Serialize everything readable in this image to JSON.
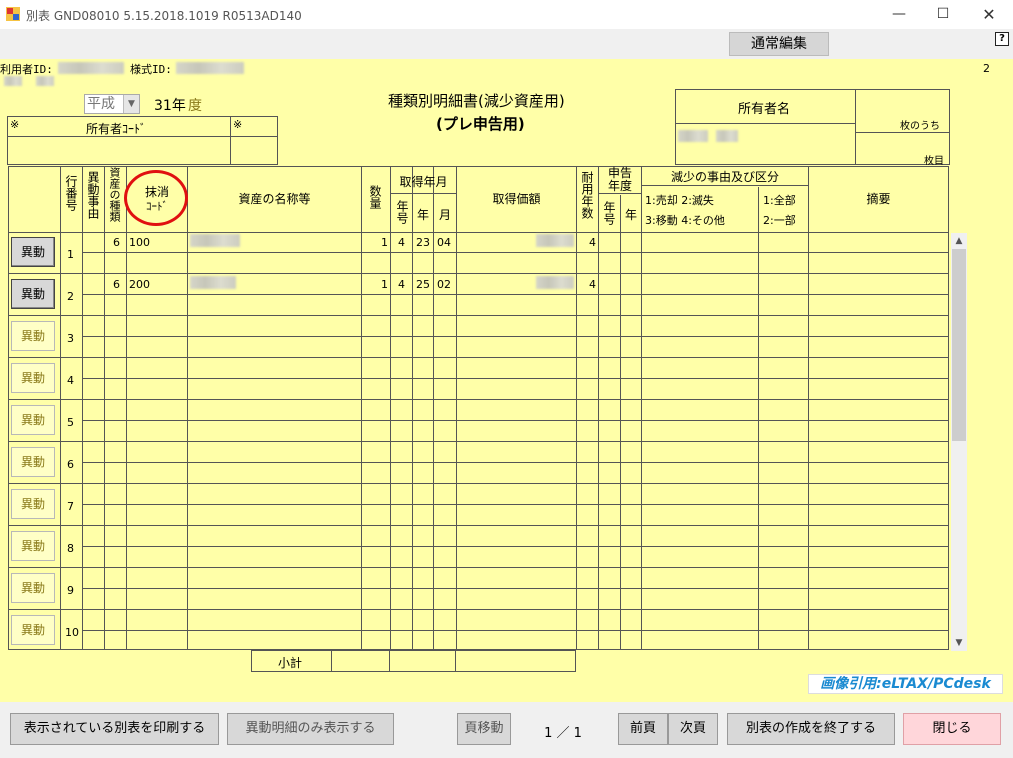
{
  "window": {
    "title": "別表 GND08010  5.15.2018.1019  R0513AD140",
    "minimize": "—",
    "maximize": "☐",
    "close": "✕"
  },
  "mode_button": "通常編集",
  "help": "?",
  "page_count": "2",
  "user_id_label": "利用者ID:",
  "form_id_label": "様式ID:",
  "era": {
    "selected": "平成",
    "year_text": "31年",
    "year_suffix": "度"
  },
  "form_title": "種類別明細書(減少資産用)",
  "form_subtitle": "(プレ申告用)",
  "owner_code": {
    "mark_left": "※",
    "label": "所有者ｺｰﾄﾞ",
    "mark_right": "※"
  },
  "owner_box": {
    "label": "所有者名",
    "sheets_of": "枚のうち",
    "sheet_no": "枚目"
  },
  "headers": {
    "row_no": "行番号",
    "change_reason": "異動事由",
    "asset_type": "資産の種類",
    "strike_code_1": "抹消",
    "strike_code_2": "ｺｰﾄﾞ",
    "asset_name": "資産の名称等",
    "quantity": "数量",
    "acq_date": "取得年月",
    "era": "年号",
    "year": "年",
    "month": "月",
    "acq_price": "取得価額",
    "useful_life": "耐用年数",
    "decl_year": "申告年度",
    "decl_era": "年号",
    "decl_y": "年",
    "reason_header": "減少の事由及び区分",
    "reason_codes_1": "1:売却 2:滅失",
    "reason_codes_2": "3:移動 4:その他",
    "scope_1": "1:全部",
    "scope_2": "2:一部",
    "remarks": "摘要"
  },
  "rows": [
    {
      "button": "異動",
      "no": "1",
      "type": "6",
      "code": "100",
      "qty": "1",
      "era": "4",
      "year": "23",
      "month": "04",
      "life": "4",
      "active": true
    },
    {
      "button": "異動",
      "no": "2",
      "type": "6",
      "code": "200",
      "qty": "1",
      "era": "4",
      "year": "25",
      "month": "02",
      "life": "4",
      "active": true
    },
    {
      "button": "異動",
      "no": "3",
      "active": false
    },
    {
      "button": "異動",
      "no": "4",
      "active": false
    },
    {
      "button": "異動",
      "no": "5",
      "active": false
    },
    {
      "button": "異動",
      "no": "6",
      "active": false
    },
    {
      "button": "異動",
      "no": "7",
      "active": false
    },
    {
      "button": "異動",
      "no": "8",
      "active": false
    },
    {
      "button": "異動",
      "no": "9",
      "active": false
    },
    {
      "button": "異動",
      "no": "10",
      "active": false
    }
  ],
  "subtotal_label": "小計",
  "credit": "画像引用:eLTAX/PCdesk",
  "footer": {
    "print": "表示されている別表を印刷する",
    "show_changes": "異動明細のみ表示する",
    "page_move": "頁移動",
    "page_indicator": "1 ／ 1",
    "prev": "前頁",
    "next": "次頁",
    "finish": "別表の作成を終了する",
    "close": "閉じる"
  },
  "colors": {
    "form_bg": "#ffffa8",
    "annotation_red": "#e01010",
    "credit_blue": "#1a8ad1",
    "close_btn": "#ffd6da"
  }
}
